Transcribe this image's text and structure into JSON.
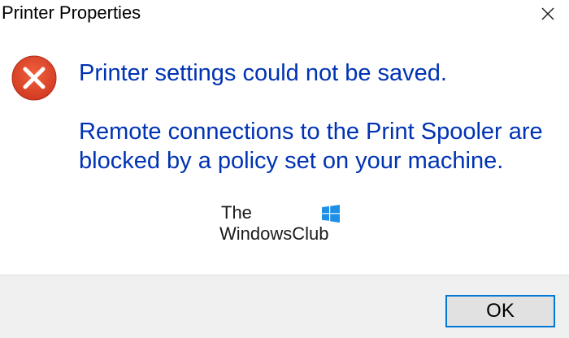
{
  "window": {
    "title": "Printer Properties",
    "close_icon": "close-icon"
  },
  "message": {
    "icon": "error-icon",
    "main": "Printer settings could not be saved.",
    "detail": "Remote connections to the Print Spooler are blocked by a policy set on your machine."
  },
  "watermark": {
    "line1": "The",
    "line2": "WindowsClub",
    "logo": "windows-logo-icon"
  },
  "footer": {
    "ok_label": "OK"
  },
  "colors": {
    "message_text": "#0033b3",
    "error_red": "#e0412f",
    "button_focus_border": "#0078d7",
    "footer_bg": "#f0f0f0",
    "logo_blue": "#1e8fe6"
  }
}
